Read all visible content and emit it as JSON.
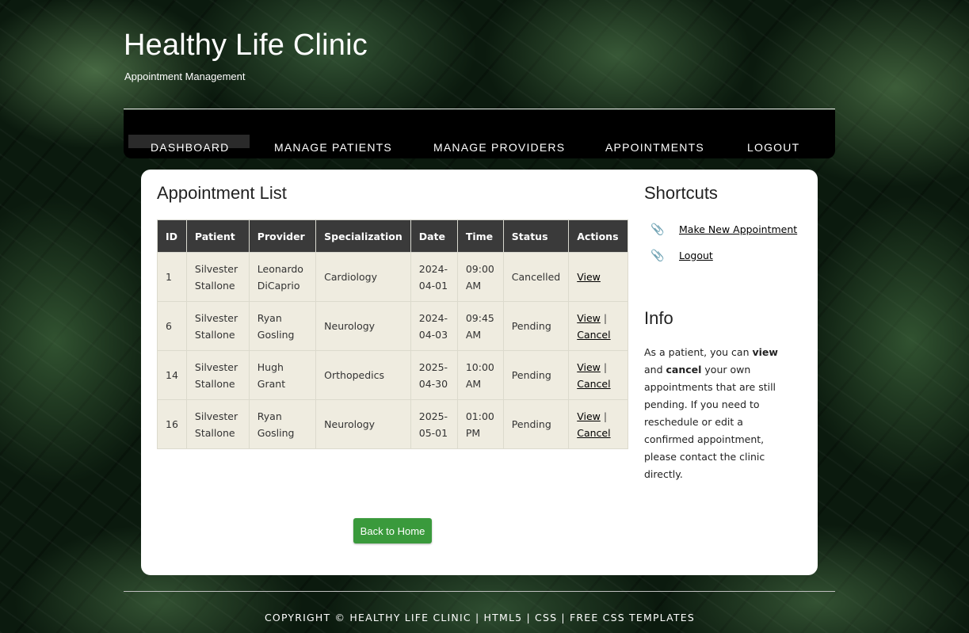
{
  "header": {
    "title": "Healthy Life Clinic",
    "tagline": "Appointment Management"
  },
  "nav": {
    "items": [
      "DASHBOARD",
      "MANAGE PATIENTS",
      "MANAGE PROVIDERS",
      "APPOINTMENTS",
      "LOGOUT"
    ],
    "active": "DASHBOARD"
  },
  "main": {
    "heading": "Appointment List",
    "columns": [
      "ID",
      "Patient",
      "Provider",
      "Specialization",
      "Date",
      "Time",
      "Status",
      "Actions"
    ],
    "rows": [
      {
        "id": "1",
        "patient": "Silvester Stallone",
        "provider": "Leonardo DiCaprio",
        "specialization": "Cardiology",
        "date": "2024-04-01",
        "time": "09:00 AM",
        "status": "Cancelled",
        "view": "View",
        "cancel": ""
      },
      {
        "id": "6",
        "patient": "Silvester Stallone",
        "provider": "Ryan Gosling",
        "specialization": "Neurology",
        "date": "2024-04-03",
        "time": "09:45 AM",
        "status": "Pending",
        "view": "View",
        "cancel": "Cancel"
      },
      {
        "id": "14",
        "patient": "Silvester Stallone",
        "provider": "Hugh Grant",
        "specialization": "Orthopedics",
        "date": "2025-04-30",
        "time": "10:00 AM",
        "status": "Pending",
        "view": "View",
        "cancel": "Cancel"
      },
      {
        "id": "16",
        "patient": "Silvester Stallone",
        "provider": "Ryan Gosling",
        "specialization": "Neurology",
        "date": "2025-05-01",
        "time": "01:00 PM",
        "status": "Pending",
        "view": "View",
        "cancel": "Cancel"
      }
    ],
    "action_separator": "|",
    "back_button": "Back to Home"
  },
  "sidebar": {
    "shortcuts_heading": "Shortcuts",
    "shortcuts": [
      "Make New Appointment",
      "Logout"
    ],
    "info_heading": "Info",
    "info": {
      "part1": "As a patient, you can ",
      "bold1": "view",
      "part2": " and ",
      "bold2": "cancel",
      "part3": " your own appointments that are still pending. If you need to reschedule or edit a confirmed appointment, please contact the clinic directly."
    }
  },
  "footer": {
    "text": "COPYRIGHT © HEALTHY LIFE CLINIC | HTML5 | CSS | FREE CSS TEMPLATES"
  },
  "colors": {
    "nav_bg": "#000000",
    "table_header_bg": "#3a3a3a",
    "table_cell_bg": "#efece0",
    "button_green": "#3a9a3c"
  },
  "icons": {
    "shortcut_icon": "paperclip-icon"
  }
}
